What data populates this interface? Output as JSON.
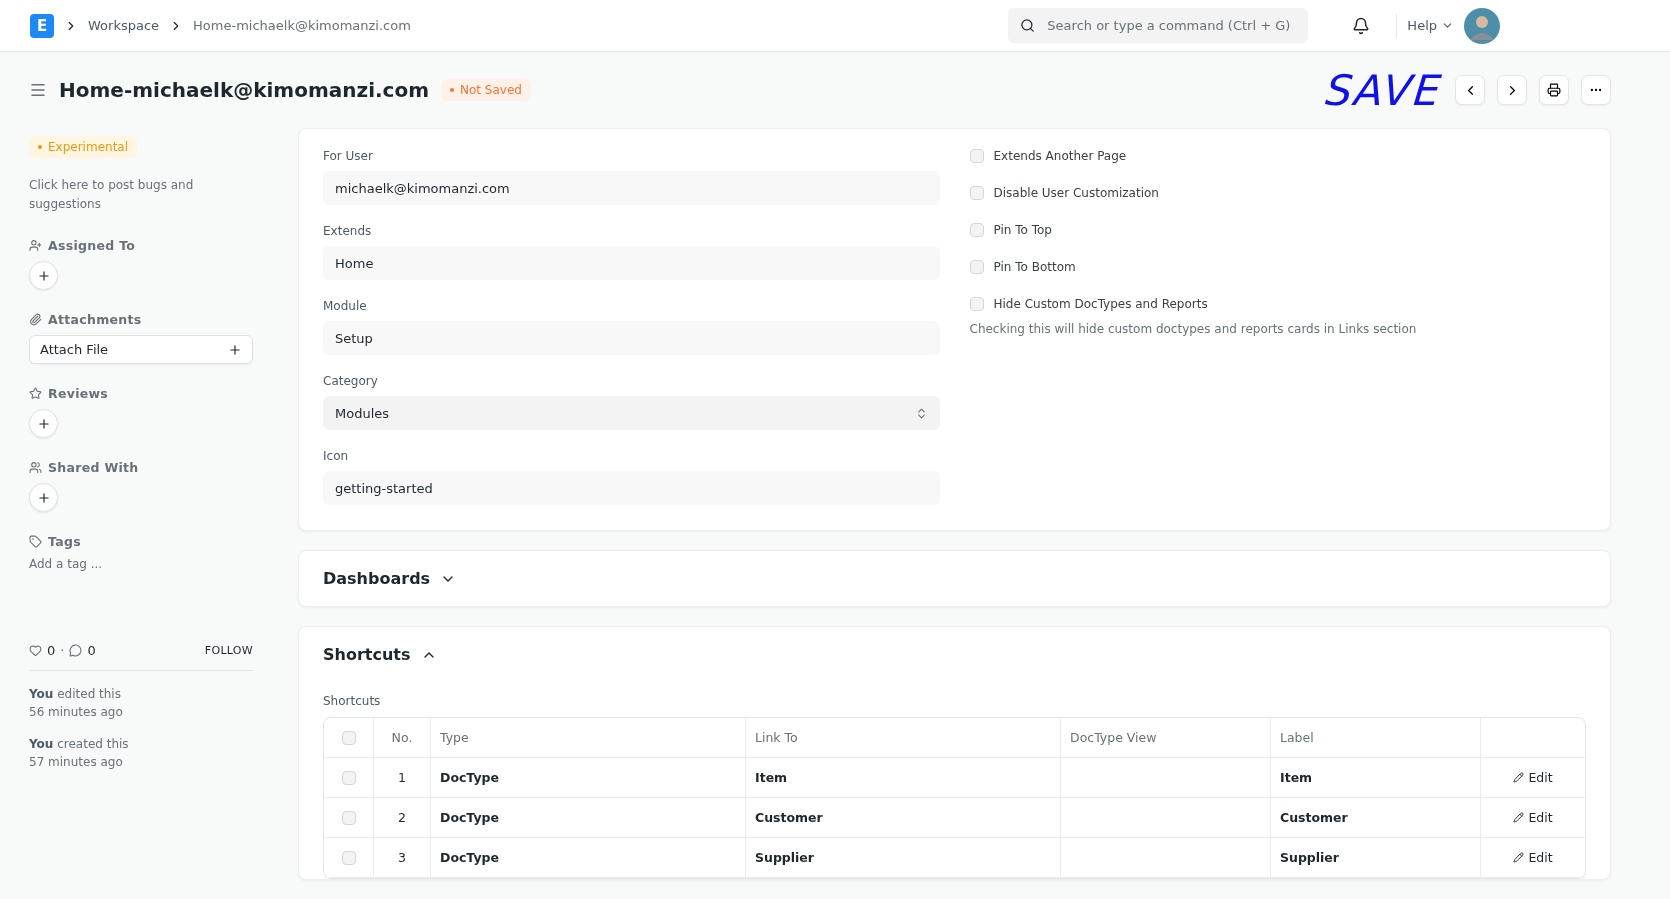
{
  "navbar": {
    "logo": "E",
    "breadcrumbs": [
      "Workspace",
      "Home-michaelk@kimomanzi.com"
    ],
    "search": {
      "placeholder": "Search or type a command (Ctrl + G)"
    },
    "help": "Help"
  },
  "page_head": {
    "title": "Home-michaelk@kimomanzi.com",
    "status": "Not Saved",
    "annotation": "SAVE"
  },
  "sidebar": {
    "badge": "Experimental",
    "feedback_link": "Click here to post bugs and suggestions",
    "sections": [
      {
        "kind": "add",
        "label": "Assigned To"
      },
      {
        "kind": "attach",
        "label": "Attachments",
        "button": "Attach File"
      },
      {
        "kind": "add",
        "label": "Reviews"
      },
      {
        "kind": "add",
        "label": "Shared With"
      },
      {
        "kind": "tags",
        "label": "Tags",
        "placeholder": "Add a tag ..."
      }
    ],
    "likes": "0",
    "separator": "·",
    "comments": "0",
    "follow": "FOLLOW",
    "activity": [
      {
        "actor": "You",
        "action": "edited this",
        "time": "56 minutes ago"
      },
      {
        "actor": "You",
        "action": "created this",
        "time": "57 minutes ago"
      }
    ]
  },
  "form": {
    "fields": [
      {
        "kind": "text",
        "label": "For User",
        "value": "michaelk@kimomanzi.com"
      },
      {
        "kind": "text",
        "label": "Extends",
        "value": "Home"
      },
      {
        "kind": "text",
        "label": "Module",
        "value": "Setup"
      },
      {
        "kind": "select",
        "label": "Category",
        "value": "Modules"
      },
      {
        "kind": "text",
        "label": "Icon",
        "value": "getting-started"
      }
    ],
    "checkboxes": [
      {
        "label": "Extends Another Page",
        "checked": false
      },
      {
        "label": "Disable User Customization",
        "checked": false
      },
      {
        "label": "Pin To Top",
        "checked": false
      },
      {
        "label": "Pin To Bottom",
        "checked": false
      },
      {
        "label": "Hide Custom DocTypes and Reports",
        "checked": false
      }
    ],
    "hint": "Checking this will hide custom doctypes and reports cards in Links section"
  },
  "sections": [
    {
      "title": "Dashboards",
      "expanded": false
    },
    {
      "title": "Shortcuts",
      "expanded": true
    }
  ],
  "shortcuts": {
    "label": "Shortcuts",
    "all_checked": false,
    "columns": [
      "No.",
      "Type",
      "Link To",
      "DocType View",
      "Label"
    ],
    "rows": [
      {
        "no": "1",
        "type": "DocType",
        "link_to": "Item",
        "label": "Item",
        "action": "Edit",
        "checked": false
      },
      {
        "no": "2",
        "type": "DocType",
        "link_to": "Customer",
        "label": "Customer",
        "action": "Edit",
        "checked": false
      },
      {
        "no": "3",
        "type": "DocType",
        "link_to": "Supplier",
        "label": "Supplier",
        "action": "Edit",
        "checked": false
      }
    ]
  }
}
